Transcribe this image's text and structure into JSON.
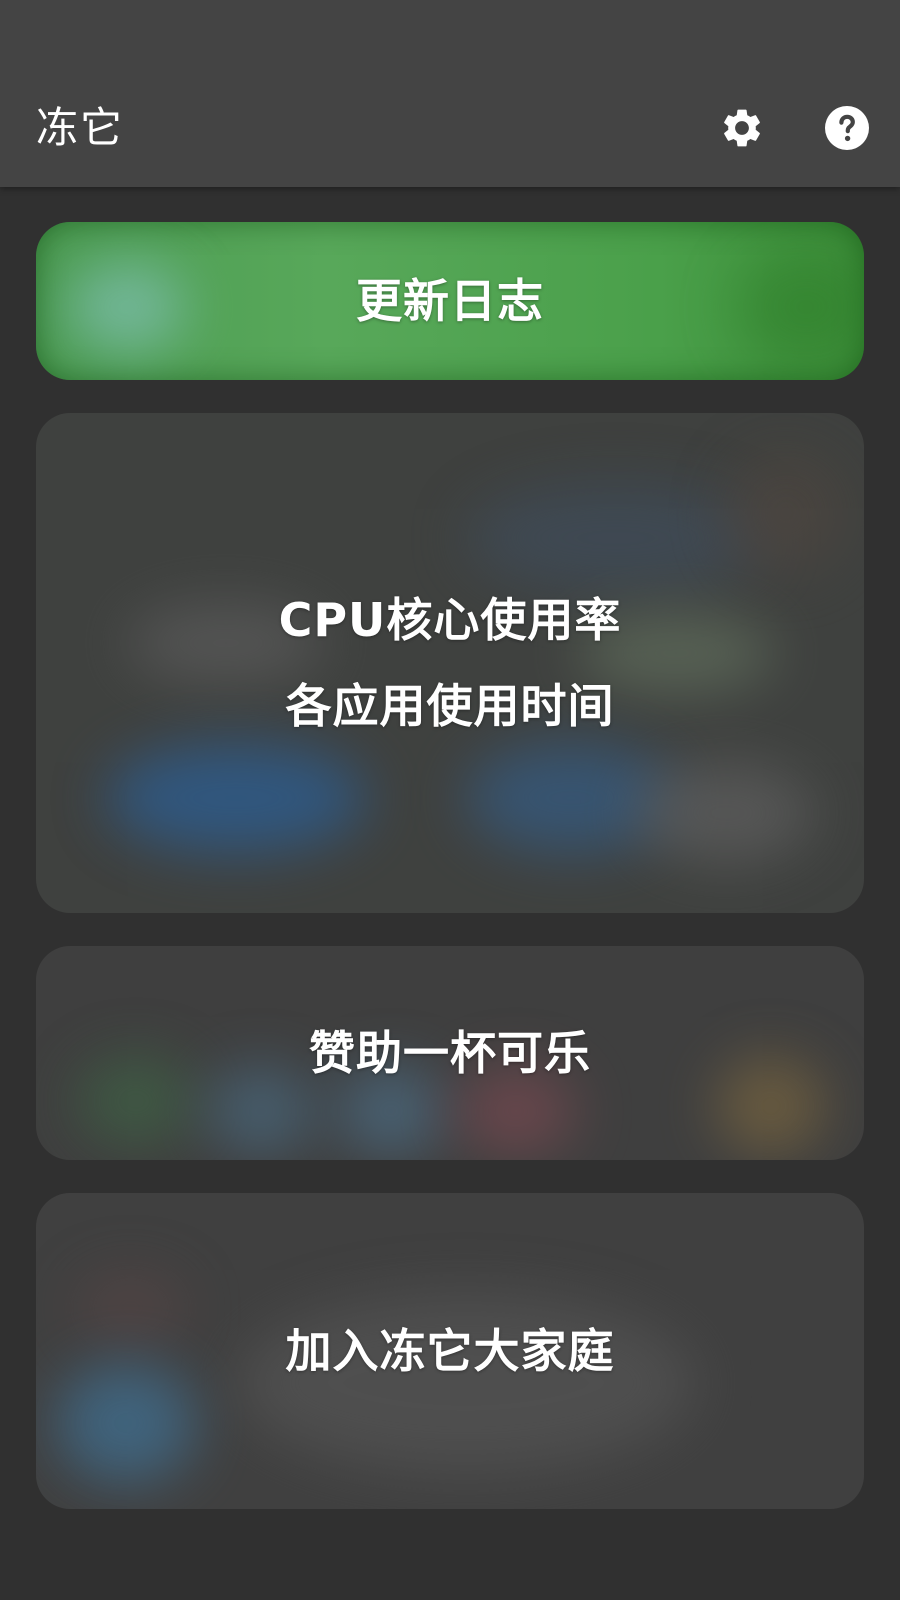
{
  "app_bar": {
    "title": "冻它",
    "settings_icon": "gear-icon",
    "help_icon": "help-circle-icon"
  },
  "cards": {
    "changelog": {
      "label": "更新日志"
    },
    "cpu": {
      "line1": "CPU核心使用率",
      "line2": "各应用使用时间"
    },
    "donate": {
      "label": "赞助一杯可乐"
    },
    "join": {
      "label": "加入冻它大家庭"
    }
  },
  "colors": {
    "app_bar_bg": "#444444",
    "page_bg": "#303030",
    "changelog_green": "#4fa450"
  }
}
